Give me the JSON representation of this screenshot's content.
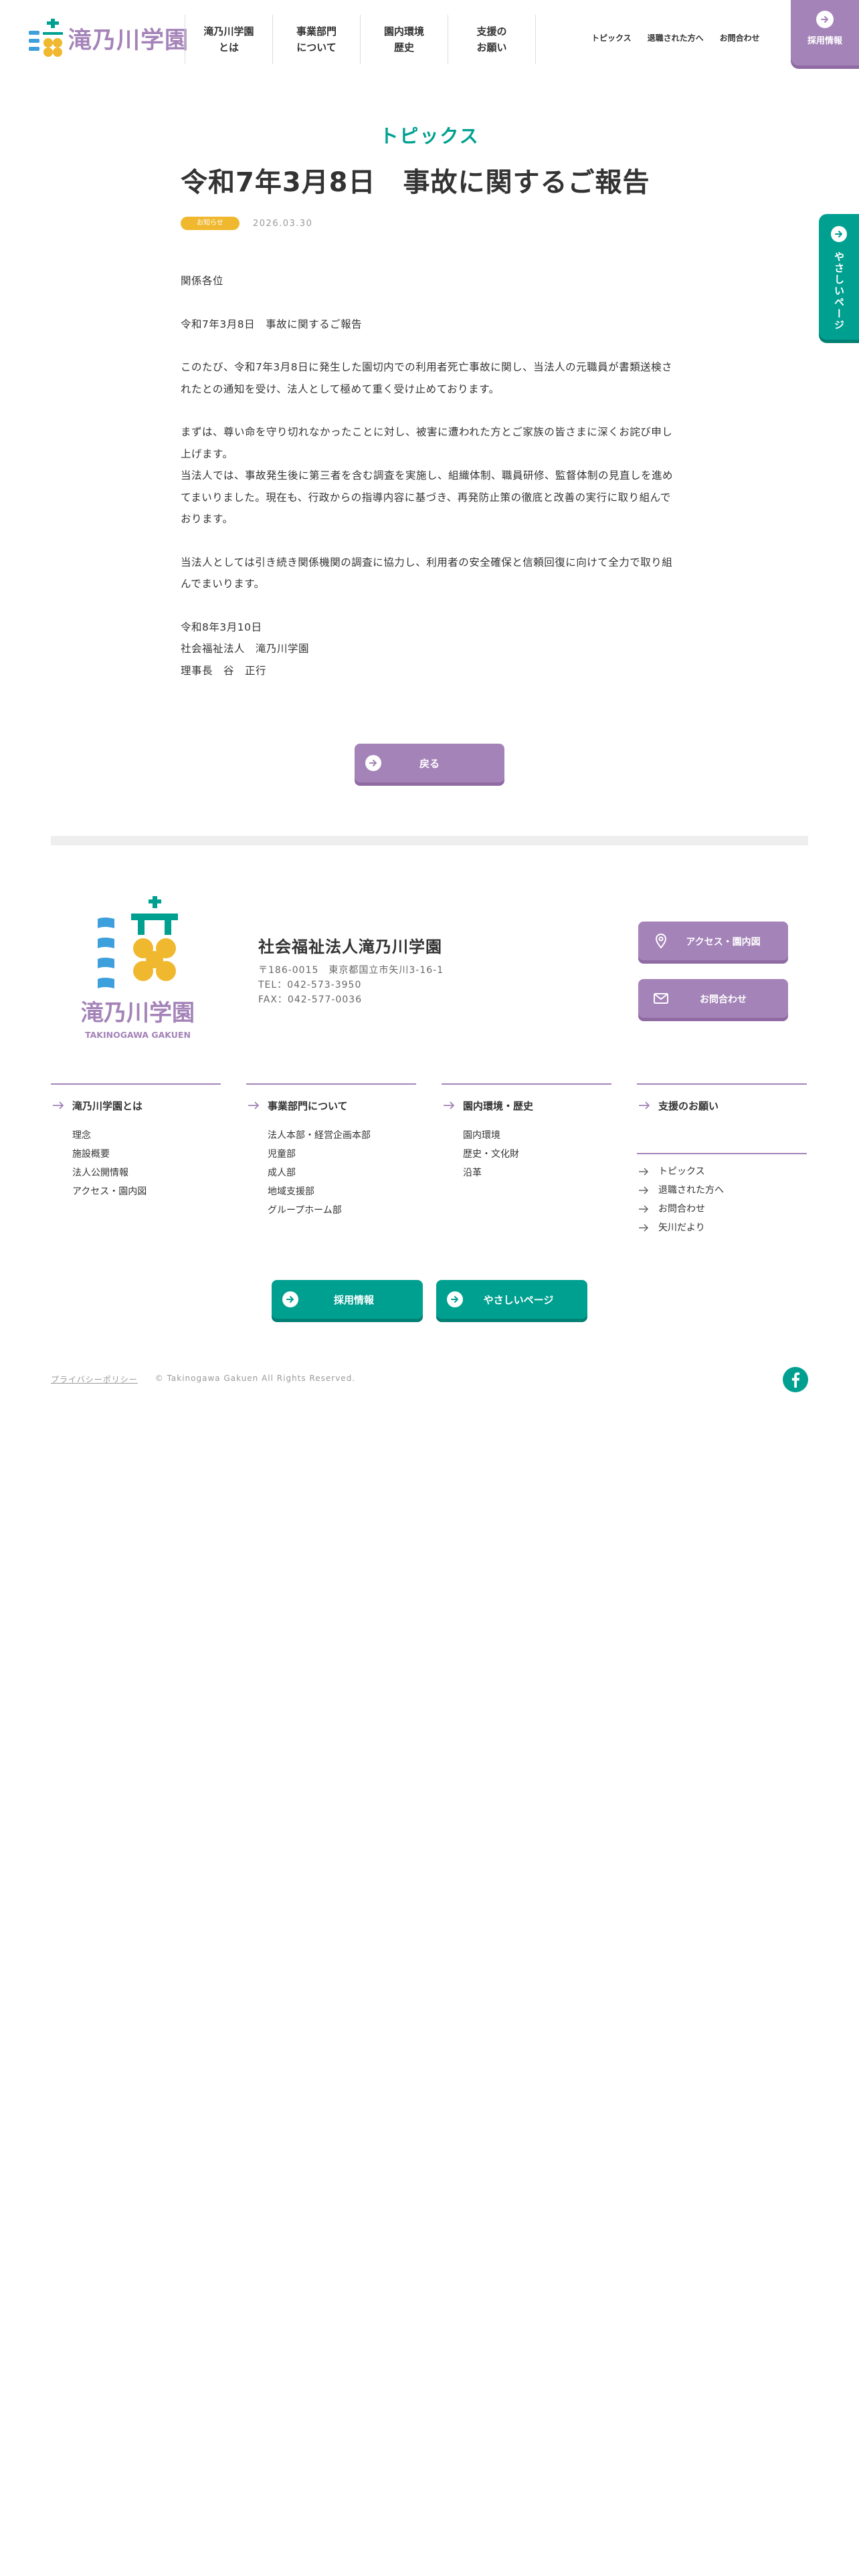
{
  "colors": {
    "purple": "#a483b8",
    "teal": "#00a091",
    "badge_yellow": "#f0b82e",
    "logo_blue": "#3d9fdc"
  },
  "header": {
    "logo_text": "滝乃川学園",
    "nav": [
      {
        "label": "滝乃川学園\nとは"
      },
      {
        "label": "事業部門\nについて"
      },
      {
        "label": "園内環境\n歴史"
      },
      {
        "label": "支援の\nお願い"
      }
    ],
    "subnav": [
      "トピックス",
      "退職された方へ",
      "お問合わせ"
    ],
    "recruit_label": "採用情報"
  },
  "side_tab": {
    "label": "やさしいページ",
    "icon": "arrow-right-circle-icon"
  },
  "article": {
    "category_heading": "トピックス",
    "title": "令和7年3月8日　事故に関するご報告",
    "badge": "お知らせ",
    "date": "2026.03.30",
    "paragraphs": [
      "関係各位",
      "令和7年3月8日　事故に関するご報告",
      "このたび、令和7年3月8日に発生した園切内での利用者死亡事故に関し、当法人の元職員が書類送検されたとの通知を受け、法人として極めて重く受け止めております。",
      "まずは、尊い命を守り切れなかったことに対し、被害に遭われた方とご家族の皆さまに深くお詫び申し上げます。\n当法人では、事故発生後に第三者を含む調査を実施し、組織体制、職員研修、監督体制の見直しを進めてまいりました。現在も、行政からの指導内容に基づき、再発防止策の徹底と改善の実行に取り組んでおります。",
      "当法人としては引き続き関係機関の調査に協力し、利用者の安全確保と信頼回復に向けて全力で取り組んでまいります。",
      "令和8年3月10日\n社会福祉法人　滝乃川学園\n理事長　谷　正行"
    ],
    "back_label": "戻る"
  },
  "footer": {
    "logo_text": "滝乃川学園",
    "logo_sub": "TAKINOGAWA GAKUEN",
    "org_name": "社会福祉法人滝乃川学園",
    "address": "〒186-0015　東京都国立市矢川3-16-1",
    "tel": "TEL：042-573-3950",
    "fax": "FAX：042-577-0036",
    "access_label": "アクセス・園内図",
    "contact_label": "お問合わせ",
    "columns": [
      {
        "heading": "滝乃川学園とは",
        "items": [
          "理念",
          "施設概要",
          "法人公開情報",
          "アクセス・園内図"
        ]
      },
      {
        "heading": "事業部門について",
        "items": [
          "法人本部・経営企画本部",
          "児童部",
          "成人部",
          "地域支援部",
          "グループホーム部"
        ]
      },
      {
        "heading": "園内環境・歴史",
        "items": [
          "園内環境",
          "歴史・文化財",
          "沿革"
        ]
      },
      {
        "heading": "支援のお願い",
        "items": [
          "トピックス",
          "退職された方へ",
          "お問合わせ",
          "矢川だより"
        ]
      }
    ],
    "recruit_label": "採用情報",
    "easy_label": "やさしいページ",
    "privacy": "プライバシーポリシー",
    "copyright": "© Takinogawa Gakuen All Rights Reserved."
  }
}
